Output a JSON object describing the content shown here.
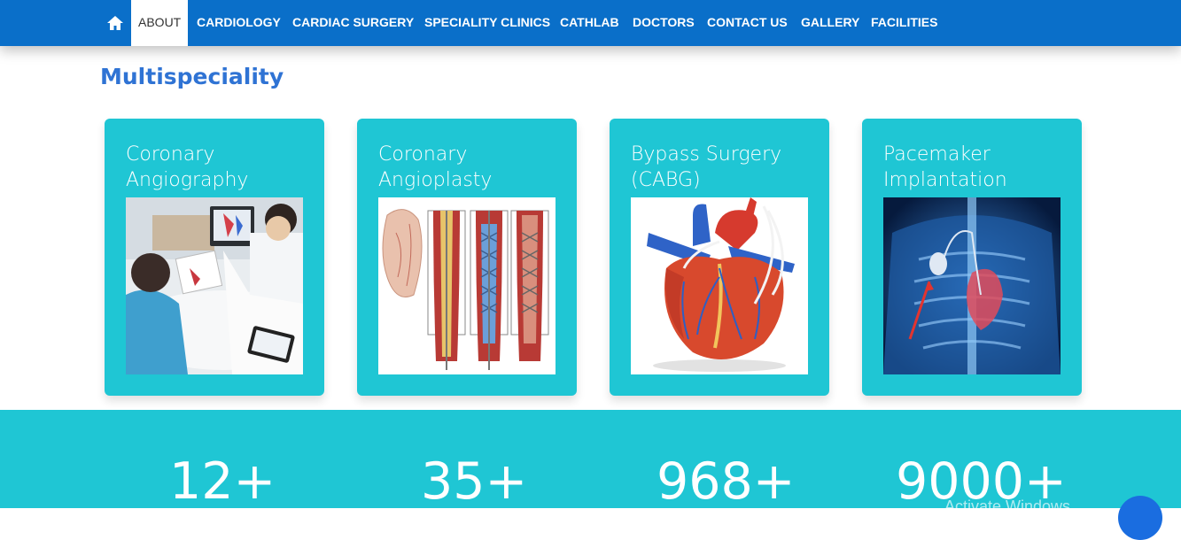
{
  "nav": {
    "home_icon": "home-icon",
    "items": [
      "ABOUT",
      "CARDIOLOGY",
      "CARDIAC SURGERY",
      "SPECIALITY CLINICS",
      "CATHLAB",
      "DOCTORS",
      "CONTACT US",
      "GALLERY",
      "FACILITIES"
    ],
    "active": "ABOUT"
  },
  "section": {
    "title": "Multispeciality"
  },
  "cards": [
    {
      "title": "Coronary Angiography",
      "image": "doctor-consultation-photo"
    },
    {
      "title": "Coronary Angioplasty",
      "image": "artery-stent-illustration"
    },
    {
      "title": "Bypass Surgery (CABG)",
      "image": "heart-bypass-illustration"
    },
    {
      "title": "Pacemaker Implantation",
      "image": "pacemaker-xray-illustration"
    }
  ],
  "stats": [
    "12+",
    "35+",
    "968+",
    "9000+"
  ],
  "os_overlay": {
    "watermark": "Activate Windows"
  },
  "colors": {
    "nav": "#0a6fc9",
    "title": "#2f73d4",
    "card": "#1fc6d4",
    "stats_band": "#1fc6d4"
  }
}
